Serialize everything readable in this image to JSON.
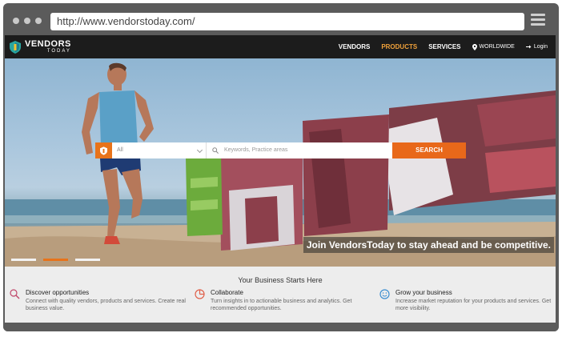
{
  "browser": {
    "url": "http://www.vendorstoday.com/"
  },
  "nav": {
    "logo_main": "VENDORS",
    "logo_sub": "TODAY",
    "links": [
      "VENDORS",
      "PRODUCTS",
      "SERVICES"
    ],
    "worldwide": "WORLDWIDE",
    "login": "Login"
  },
  "hero": {
    "search": {
      "category_value": "All",
      "keyword_placeholder": "Keywords, Practice areas",
      "button_label": "SEARCH"
    },
    "caption": "Join VendorsToday to stay ahead and be competitive."
  },
  "features": {
    "title": "Your Business Starts Here",
    "items": [
      {
        "heading": "Discover opportunities",
        "description": "Connect with quality vendors, products and services. Create real business value."
      },
      {
        "heading": "Collaborate",
        "description": "Turn insights in to actionable business and analytics. Get recommended opportunities."
      },
      {
        "heading": "Grow your business",
        "description": "Increase market reputation for your products and services. Get more visibility."
      }
    ]
  },
  "colors": {
    "accent": "#e8731a",
    "active_nav": "#f0a13a",
    "nav_bg": "#1c1c1c"
  }
}
